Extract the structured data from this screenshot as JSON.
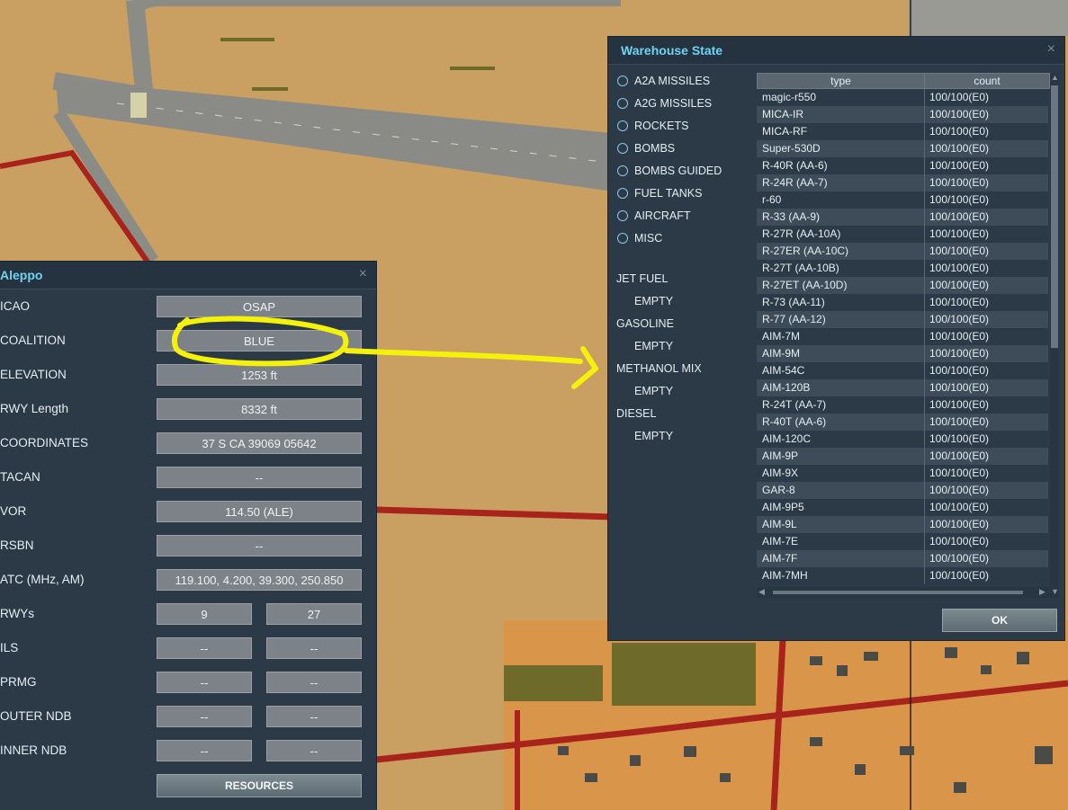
{
  "aerodrome": {
    "title": "Aleppo",
    "close_glyph": "×",
    "fields": [
      {
        "label": "ICAO",
        "value": "OSAP"
      },
      {
        "label": "COALITION",
        "value": "BLUE"
      },
      {
        "label": "ELEVATION",
        "value": "1253 ft"
      },
      {
        "label": "RWY Length",
        "value": "8332 ft"
      },
      {
        "label": "COORDINATES",
        "value": "37 S CA 39069 05642"
      },
      {
        "label": "TACAN",
        "value": "--"
      },
      {
        "label": "VOR",
        "value": "114.50 (ALE)"
      },
      {
        "label": "RSBN",
        "value": "--"
      },
      {
        "label": "ATC  (MHz, AM)",
        "value": "119.100, 4.200, 39.300, 250.850"
      }
    ],
    "pair_fields": [
      {
        "label": "RWYs",
        "a": "9",
        "b": "27"
      },
      {
        "label": "ILS",
        "a": "--",
        "b": "--"
      },
      {
        "label": "PRMG",
        "a": "--",
        "b": "--"
      },
      {
        "label": "OUTER NDB",
        "a": "--",
        "b": "--"
      },
      {
        "label": "INNER NDB",
        "a": "--",
        "b": "--"
      }
    ],
    "resources_button": "RESOURCES"
  },
  "warehouse": {
    "title": "Warehouse State",
    "close_glyph": "×",
    "categories": [
      "A2A MISSILES",
      "A2G MISSILES",
      "ROCKETS",
      "BOMBS",
      "BOMBS GUIDED",
      "FUEL TANKS",
      "AIRCRAFT",
      "MISC"
    ],
    "fuels": [
      {
        "name": "JET FUEL",
        "state": "EMPTY"
      },
      {
        "name": "GASOLINE",
        "state": "EMPTY"
      },
      {
        "name": "METHANOL MIX",
        "state": "EMPTY"
      },
      {
        "name": "DIESEL",
        "state": "EMPTY"
      }
    ],
    "table": {
      "columns": [
        "type",
        "count"
      ],
      "rows": [
        [
          "magic-r550",
          "100/100(E0)"
        ],
        [
          "MICA-IR",
          "100/100(E0)"
        ],
        [
          "MICA-RF",
          "100/100(E0)"
        ],
        [
          "Super-530D",
          "100/100(E0)"
        ],
        [
          "R-40R (AA-6)",
          "100/100(E0)"
        ],
        [
          "R-24R (AA-7)",
          "100/100(E0)"
        ],
        [
          "r-60",
          "100/100(E0)"
        ],
        [
          "R-33 (AA-9)",
          "100/100(E0)"
        ],
        [
          "R-27R (AA-10A)",
          "100/100(E0)"
        ],
        [
          "R-27ER (AA-10C)",
          "100/100(E0)"
        ],
        [
          "R-27T (AA-10B)",
          "100/100(E0)"
        ],
        [
          "R-27ET (AA-10D)",
          "100/100(E0)"
        ],
        [
          "R-73 (AA-11)",
          "100/100(E0)"
        ],
        [
          "R-77 (AA-12)",
          "100/100(E0)"
        ],
        [
          "AIM-7M",
          "100/100(E0)"
        ],
        [
          "AIM-9M",
          "100/100(E0)"
        ],
        [
          "AIM-54C",
          "100/100(E0)"
        ],
        [
          "AIM-120B",
          "100/100(E0)"
        ],
        [
          "R-24T (AA-7)",
          "100/100(E0)"
        ],
        [
          "R-40T (AA-6)",
          "100/100(E0)"
        ],
        [
          "AIM-120C",
          "100/100(E0)"
        ],
        [
          "AIM-9P",
          "100/100(E0)"
        ],
        [
          "AIM-9X",
          "100/100(E0)"
        ],
        [
          "GAR-8",
          "100/100(E0)"
        ],
        [
          "AIM-9P5",
          "100/100(E0)"
        ],
        [
          "AIM-9L",
          "100/100(E0)"
        ],
        [
          "AIM-7E",
          "100/100(E0)"
        ],
        [
          "AIM-7F",
          "100/100(E0)"
        ],
        [
          "AIM-7MH",
          "100/100(E0)"
        ]
      ]
    },
    "ok_button": "OK"
  },
  "colors": {
    "panel_bg": "#2c3a48",
    "title_accent": "#6fd3f0",
    "field_bg": "#7c8287",
    "annotation_yellow": "#f5f20a",
    "road_red": "#a8231b",
    "map_sand": "#c9a061"
  }
}
